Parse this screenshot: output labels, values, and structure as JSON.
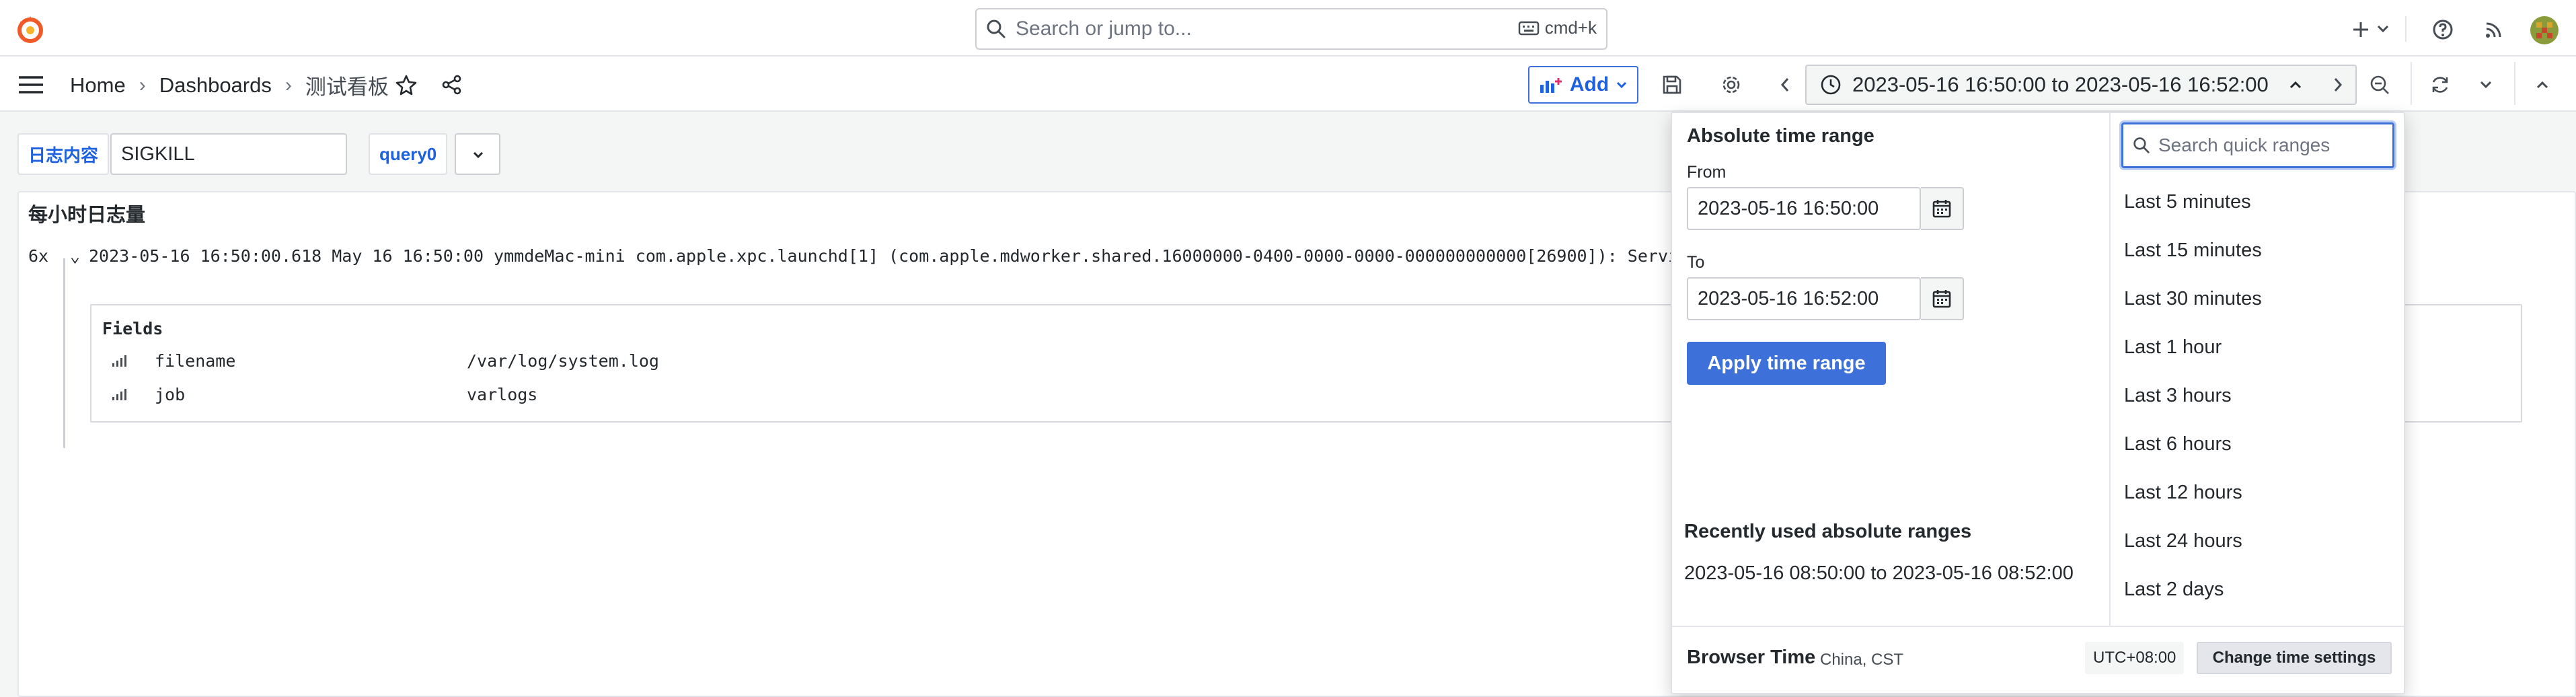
{
  "topbar": {
    "search_placeholder": "Search or jump to...",
    "shortcut": "cmd+k"
  },
  "breadcrumb": {
    "home": "Home",
    "dashboards": "Dashboards",
    "current": "测试看板"
  },
  "toolbar": {
    "add_label": "Add",
    "time_range": "2023-05-16 16:50:00 to 2023-05-16 16:52:00"
  },
  "variables": {
    "log_content_label": "日志内容",
    "log_content_value": "SIGKILL",
    "query_label": "query0"
  },
  "panel": {
    "title": "每小时日志量",
    "log": {
      "count": "6x",
      "text": "2023-05-16 16:50:00.618 May 16 16:50:00 ymmdeMac-mini com.apple.xpc.launchd[1] (com.apple.mdworker.shared.16000000-0400-0000-0000-000000000000[26900]): Service"
    },
    "fields_title": "Fields",
    "fields": [
      {
        "key": "filename",
        "value": "/var/log/system.log"
      },
      {
        "key": "job",
        "value": "varlogs"
      }
    ]
  },
  "time_dropdown": {
    "heading": "Absolute time range",
    "from_label": "From",
    "from_value": "2023-05-16 16:50:00",
    "to_label": "To",
    "to_value": "2023-05-16 16:52:00",
    "apply_label": "Apply time range",
    "recent_heading": "Recently used absolute ranges",
    "recent_item": "2023-05-16 08:50:00 to 2023-05-16 08:52:00",
    "quick_search_placeholder": "Search quick ranges",
    "quick_ranges": [
      "Last 5 minutes",
      "Last 15 minutes",
      "Last 30 minutes",
      "Last 1 hour",
      "Last 3 hours",
      "Last 6 hours",
      "Last 12 hours",
      "Last 24 hours",
      "Last 2 days"
    ],
    "browser_time_label": "Browser Time",
    "browser_tz": "China, CST",
    "utc_offset": "UTC+08:00",
    "change_settings_label": "Change time settings"
  },
  "colors": {
    "accent": "#3d71d9",
    "link": "#1f62e0",
    "logo": "#f05a28"
  }
}
